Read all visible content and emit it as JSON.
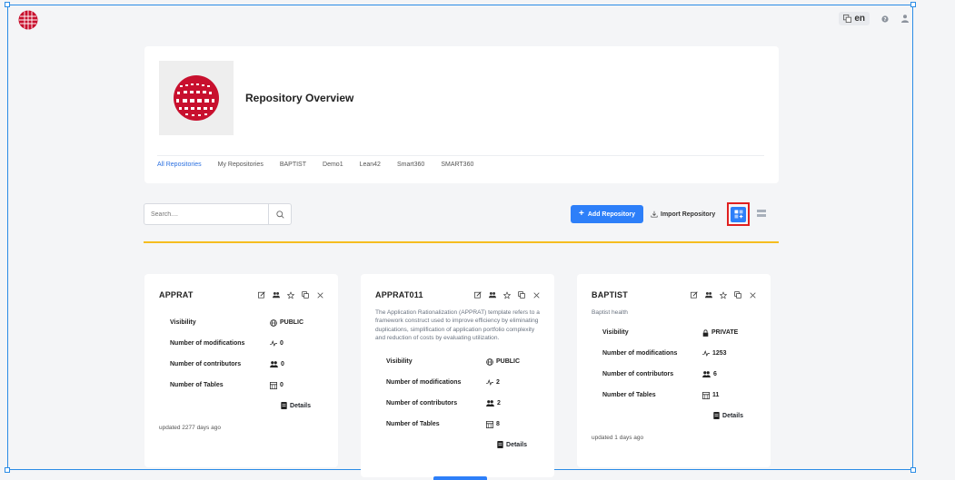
{
  "topbar": {
    "language": "en"
  },
  "header": {
    "title": "Repository Overview",
    "tabs": [
      {
        "label": "All Repositories"
      },
      {
        "label": "My Repositories"
      },
      {
        "label": "BAPTIST"
      },
      {
        "label": "Demo1"
      },
      {
        "label": "Lean42"
      },
      {
        "label": "Smart360"
      },
      {
        "label": "SMART360"
      }
    ],
    "active_tab": "All Repositories"
  },
  "toolbar": {
    "search_placeholder": "Search....",
    "add_label": "Add Repository",
    "import_label": "Import Repository"
  },
  "labels": {
    "visibility": "Visibility",
    "modifications": "Number of modifications",
    "contributors": "Number of contributors",
    "tables": "Number of Tables",
    "details": "Details"
  },
  "cards": [
    {
      "title": "APPRAT",
      "description": "",
      "visibility": "PUBLIC",
      "modifications": "0",
      "contributors": "0",
      "tables": "0",
      "updated": "updated 2277 days ago"
    },
    {
      "title": "APPRAT011",
      "description": "The Application Rationalization (APPRAT) template refers to a framework construct used to improve efficiency by eliminating duplications, simplification of application portfolio complexity and reduction of costs by evaluating utilization.",
      "visibility": "PUBLIC",
      "modifications": "2",
      "contributors": "2",
      "tables": "8",
      "updated": ""
    },
    {
      "title": "BAPTIST",
      "description": "Baptist health",
      "visibility": "PRIVATE",
      "modifications": "1253",
      "contributors": "6",
      "tables": "11",
      "updated": "updated 1 days ago"
    }
  ],
  "colors": {
    "accent": "#2d7ff9",
    "divider": "#f5bd1f",
    "brand": "#c8102e",
    "highlight": "#e02020"
  }
}
